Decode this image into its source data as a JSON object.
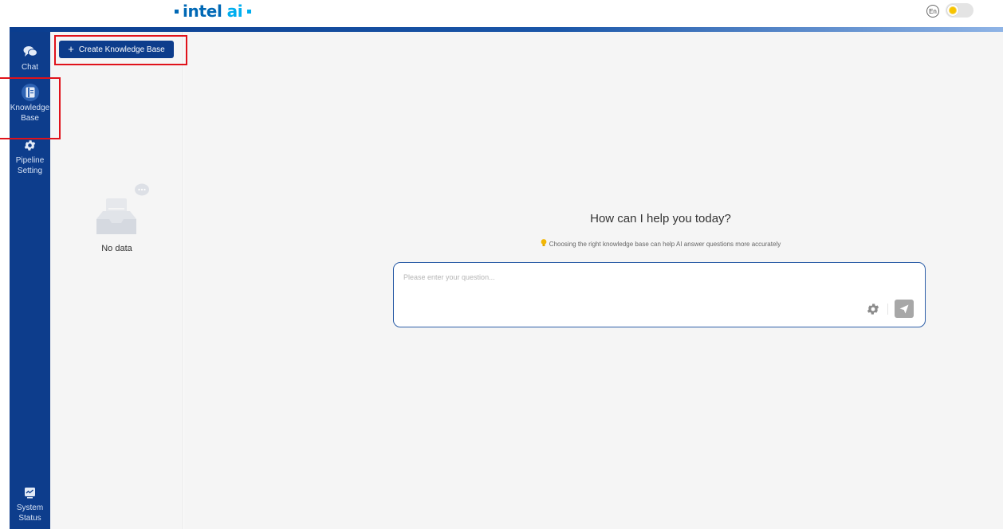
{
  "header": {
    "logo_word1": "intel",
    "logo_word2": "ai",
    "language_label": "En"
  },
  "sidebar": {
    "items": [
      {
        "label": "Chat",
        "icon": "chat-icon"
      },
      {
        "label": "Knowledge Base",
        "label_line1": "Knowledge",
        "label_line2": "Base",
        "icon": "knowledge-base-icon",
        "active": true
      },
      {
        "label": "Pipeline Setting",
        "label_line1": "Pipeline",
        "label_line2": "Setting",
        "icon": "gear-icon"
      },
      {
        "label": "System Status",
        "label_line1": "System",
        "label_line2": "Status",
        "icon": "monitor-icon"
      }
    ]
  },
  "knowledge_panel": {
    "create_button": "Create Knowledge Base",
    "empty_text": "No data"
  },
  "main": {
    "greeting": "How can I help you today?",
    "tip": "Choosing the right knowledge base can help AI answer questions more accurately",
    "input_placeholder": "Please enter your question..."
  },
  "colors": {
    "brand_blue": "#0d3d8c",
    "intel_blue": "#0068b5",
    "ai_cyan": "#00aeef",
    "annotation_red": "#e0121a"
  }
}
